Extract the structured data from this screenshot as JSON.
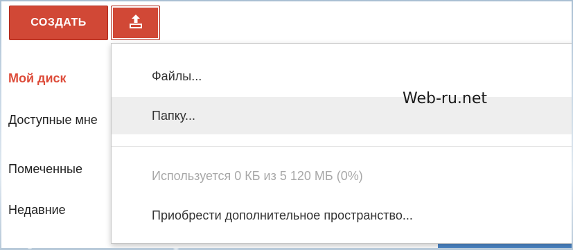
{
  "toolbar": {
    "create_label": "СОЗДАТЬ"
  },
  "sidebar": {
    "items": [
      {
        "label": "Мой диск",
        "active": true
      },
      {
        "label": "Доступные мне"
      },
      {
        "label": "Помеченные"
      },
      {
        "label": "Недавние"
      }
    ]
  },
  "upload_menu": {
    "items": [
      {
        "label": "Файлы..."
      },
      {
        "label": "Папку..."
      }
    ],
    "storage_usage": "Используется 0 КБ из 5 120 МБ (0%)",
    "buy_storage": "Приобрести дополнительное пространство..."
  },
  "watermark": "Web-ru.net",
  "colors": {
    "accent": "#d14836",
    "active_nav": "#dd4b39",
    "hover_bg": "#eeeeee"
  },
  "icons": {
    "upload": "upload-icon"
  }
}
